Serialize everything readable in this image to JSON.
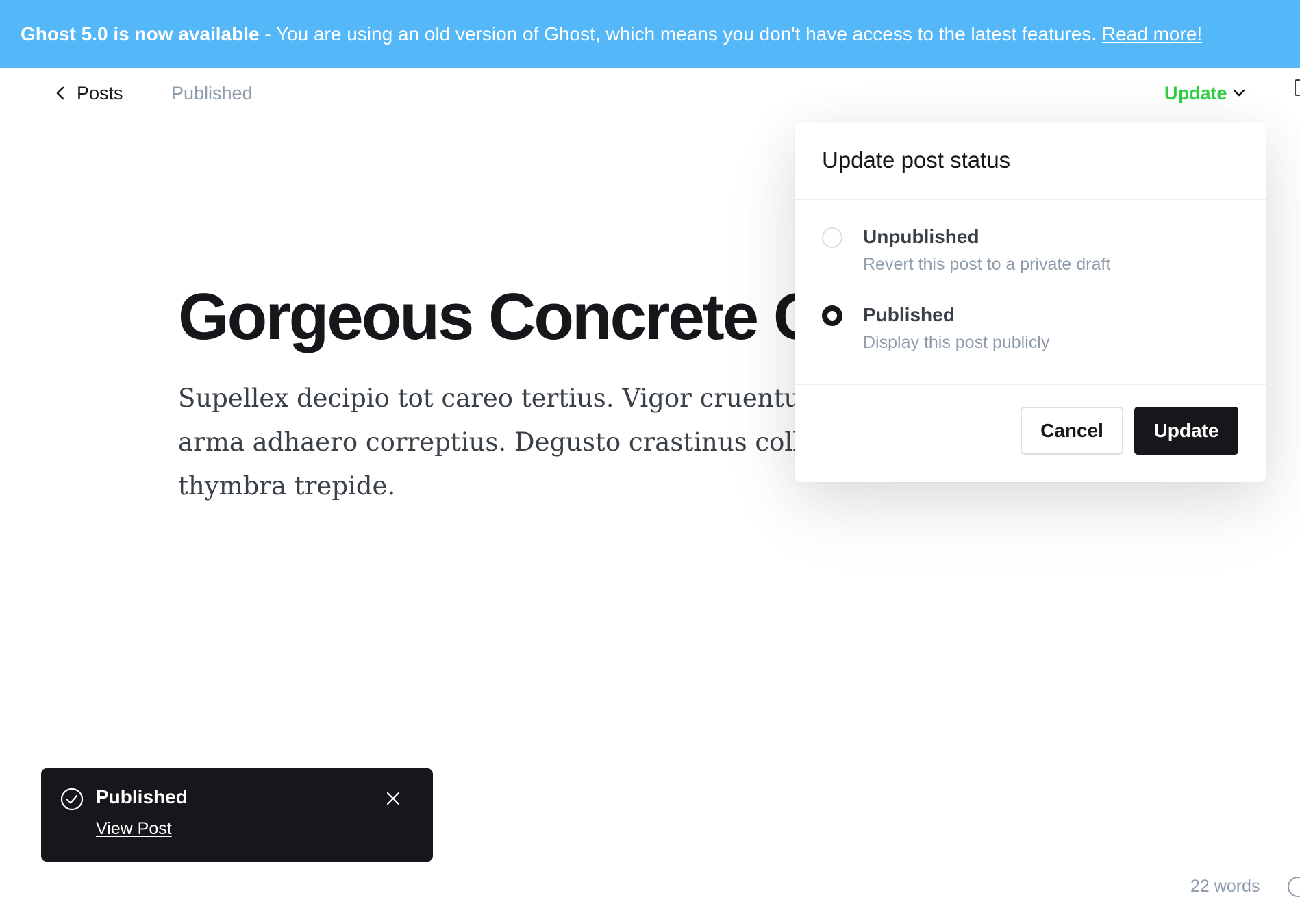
{
  "banner": {
    "bold": "Ghost 5.0 is now available",
    "text": " - You are using an old version of Ghost, which means you don't have access to the latest features. ",
    "link": "Read more!"
  },
  "topbar": {
    "back_label": "Posts",
    "status": "Published",
    "update_label": "Update"
  },
  "post": {
    "title": "Gorgeous Concrete C",
    "body_lines": [
      "Supellex decipio tot careo tertius. Vigor cruentus co",
      "arma adhaero correptius. Degusto crastinus collum",
      "thymbra trepide."
    ]
  },
  "dropdown": {
    "title": "Update post status",
    "options": [
      {
        "label": "Unpublished",
        "description": "Revert this post to a private draft",
        "checked": false
      },
      {
        "label": "Published",
        "description": "Display this post publicly",
        "checked": true
      }
    ],
    "cancel_label": "Cancel",
    "update_label": "Update"
  },
  "toast": {
    "title": "Published",
    "link": "View Post"
  },
  "footer": {
    "word_count": "22 words"
  },
  "colors": {
    "banner": "#54b7f8",
    "accent_green": "#30cf43",
    "dark": "#15171a",
    "muted": "#8e9cac"
  }
}
